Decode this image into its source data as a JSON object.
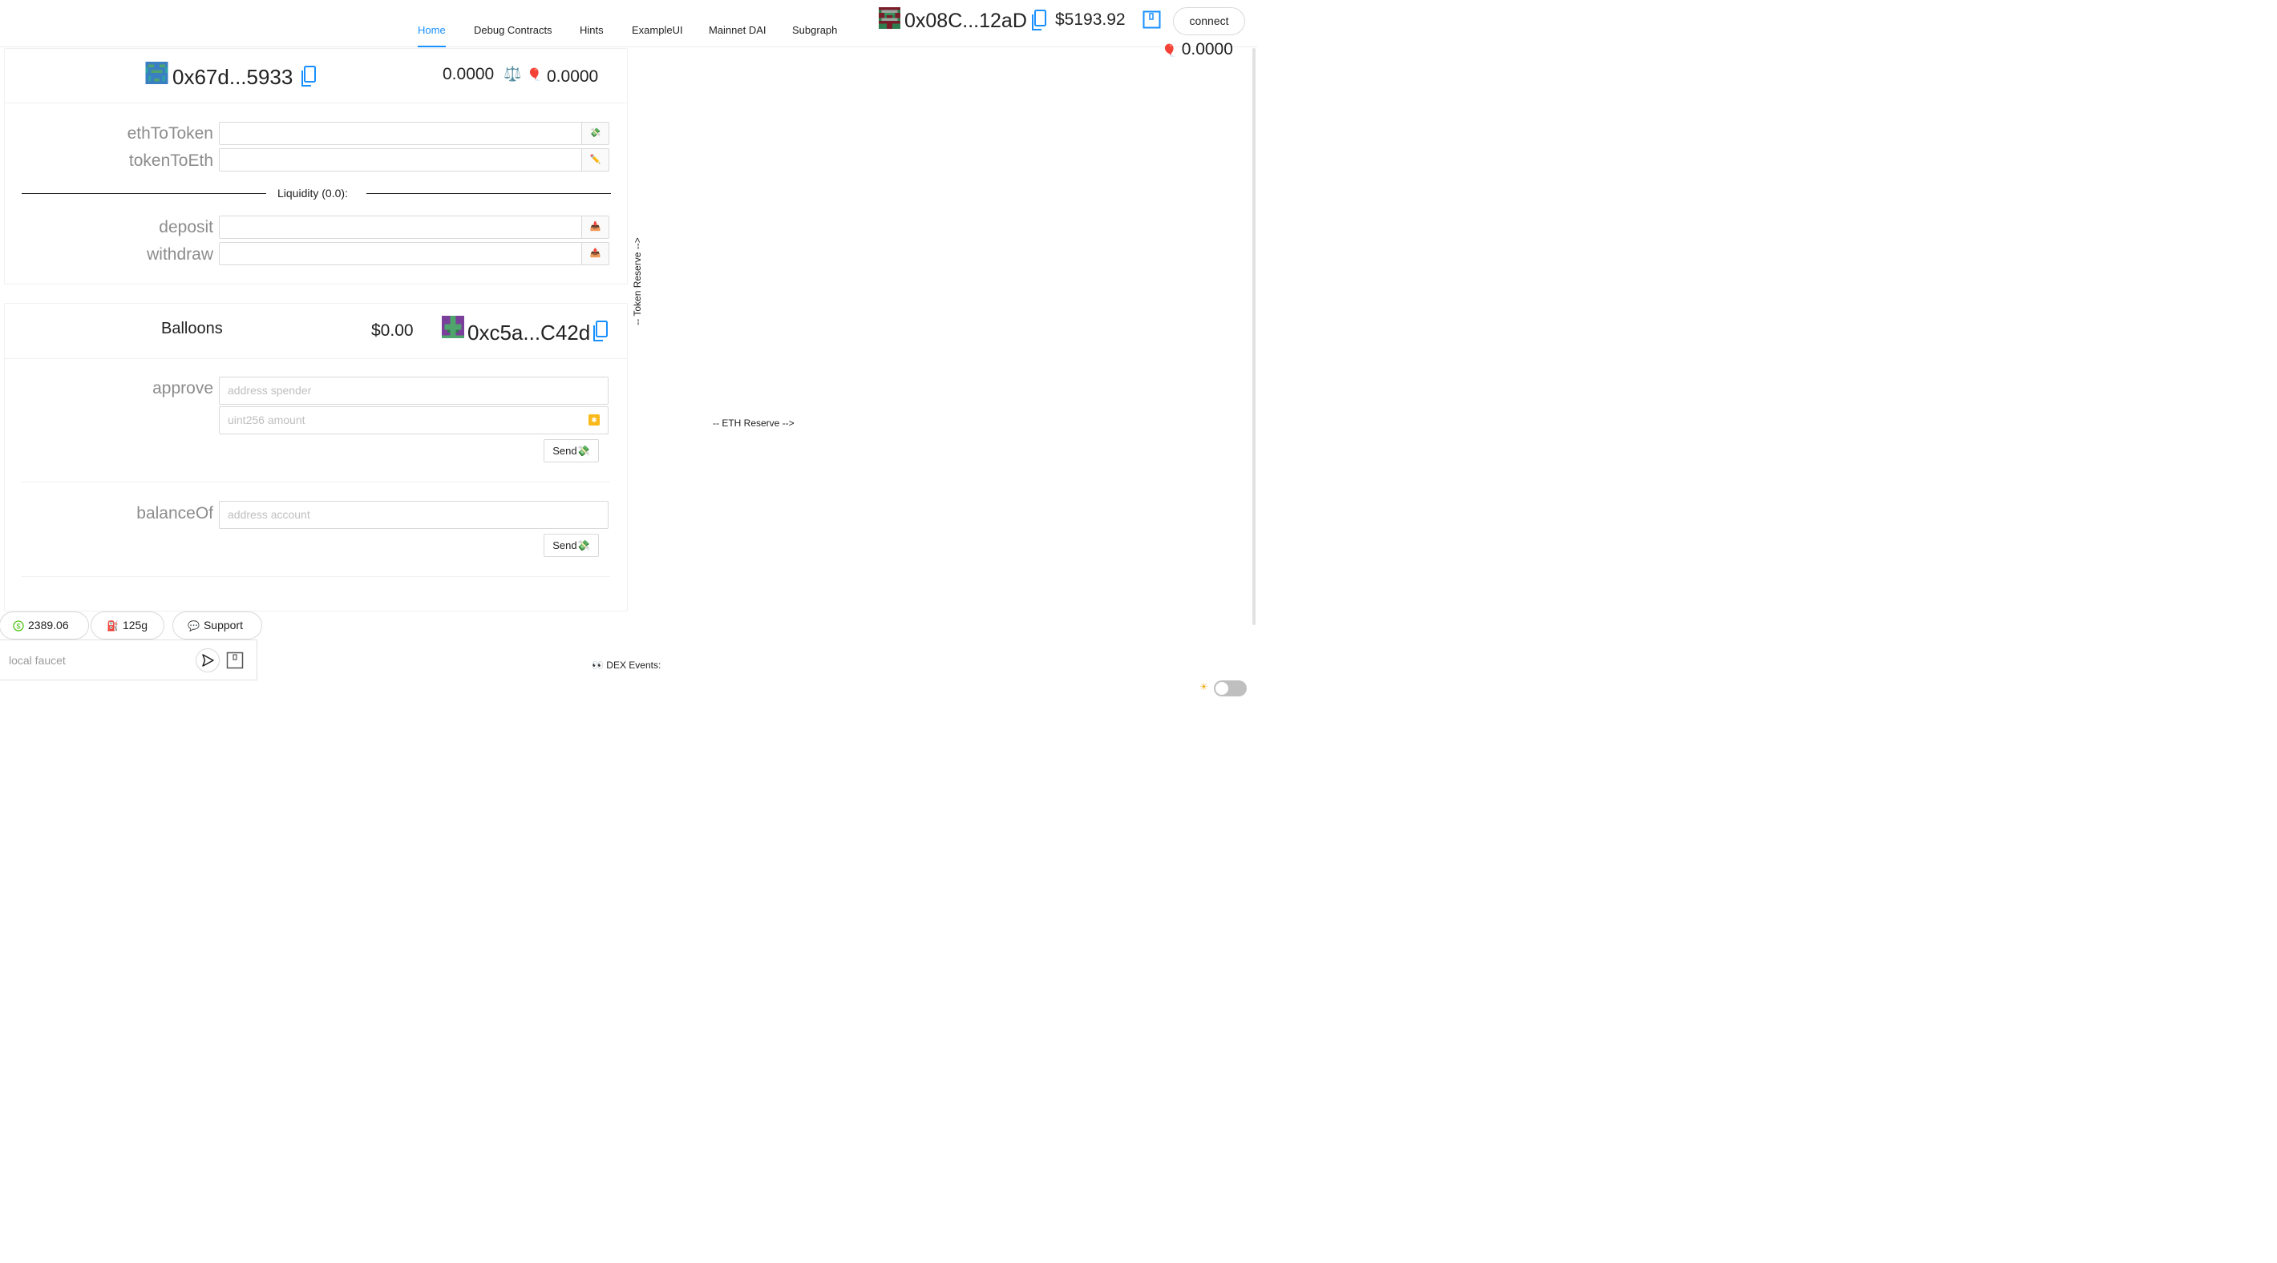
{
  "nav": {
    "items": [
      {
        "label": "Home",
        "active": true
      },
      {
        "label": "Debug Contracts"
      },
      {
        "label": "Hints"
      },
      {
        "label": "ExampleUI"
      },
      {
        "label": "Mainnet DAI"
      },
      {
        "label": "Subgraph"
      }
    ],
    "accent": "#1890ff"
  },
  "account": {
    "address": "0x08C...12aD",
    "balance": "$5193.92",
    "connect_label": "connect",
    "token_balance": "0.0000"
  },
  "dex": {
    "address": "0x67d...5933",
    "eth_balance": "0.0000",
    "token_balance": "0.0000",
    "fields": [
      {
        "label": "ethToToken",
        "icon": "money-wings-icon"
      },
      {
        "label": "tokenToEth",
        "icon": "pencil-icon"
      }
    ],
    "liquidity_label": "Liquidity (0.0):",
    "liquidity_fields": [
      {
        "label": "deposit",
        "icon": "inbox-tray-icon"
      },
      {
        "label": "withdraw",
        "icon": "inbox-tray-icon"
      }
    ]
  },
  "balloons": {
    "title": "Balloons",
    "usd": "$0.00",
    "address": "0xc5a...C42d",
    "approve": {
      "label": "approve",
      "spender_placeholder": "address spender",
      "amount_placeholder": "uint256 amount",
      "send_label": "Send💸"
    },
    "balanceOf": {
      "label": "balanceOf",
      "account_placeholder": "address account",
      "send_label": "Send💸"
    }
  },
  "reserves": {
    "token_label": "-- Token Reserve -->",
    "eth_label": "-- ETH Reserve -->"
  },
  "footer": {
    "price": "2389.06",
    "gas": "125g",
    "support_label": "Support",
    "faucet_placeholder": "local faucet",
    "dex_events_label": "👀 DEX Events:"
  }
}
